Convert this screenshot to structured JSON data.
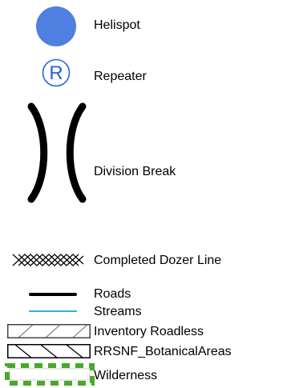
{
  "legend": {
    "items": [
      {
        "label": "Helispot",
        "icon": "helispot-circle-icon",
        "color": "#4f7fe0"
      },
      {
        "label": "Repeater",
        "icon": "repeater-r-icon",
        "color": "#2a5fd6",
        "glyph": "R"
      },
      {
        "label": "Division Break",
        "icon": "division-break-icon",
        "color": "#000000"
      },
      {
        "label": "Completed Dozer Line",
        "icon": "dozer-line-crosshatch-icon",
        "color": "#000000"
      },
      {
        "label": "Roads",
        "icon": "road-line-icon",
        "color": "#000000"
      },
      {
        "label": "Streams",
        "icon": "stream-line-icon",
        "color": "#1aa3d9"
      },
      {
        "label": "Inventory Roadless",
        "icon": "hatched-box-icon",
        "color": "#555555"
      },
      {
        "label": "RRSNF_BotanicalAreas",
        "icon": "back-hatched-box-icon",
        "color": "#000000"
      },
      {
        "label": "Wilderness",
        "icon": "dashed-green-box-icon",
        "color": "#4aa82a"
      }
    ]
  }
}
